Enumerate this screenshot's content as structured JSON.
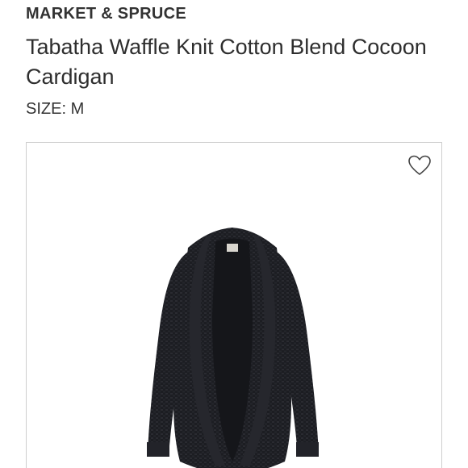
{
  "product": {
    "brand": "MARKET & SPRUCE",
    "title": "Tabatha Waffle Knit Cotton Blend Cocoon Cardigan",
    "size_label": "SIZE:",
    "size_value": "M",
    "image_alt": "black waffle knit cocoon cardigan",
    "favorite_icon": "heart-outline-icon"
  },
  "colors": {
    "text": "#2e2e2e",
    "card_border": "#cfcfcf",
    "garment": "#1c1d22"
  }
}
